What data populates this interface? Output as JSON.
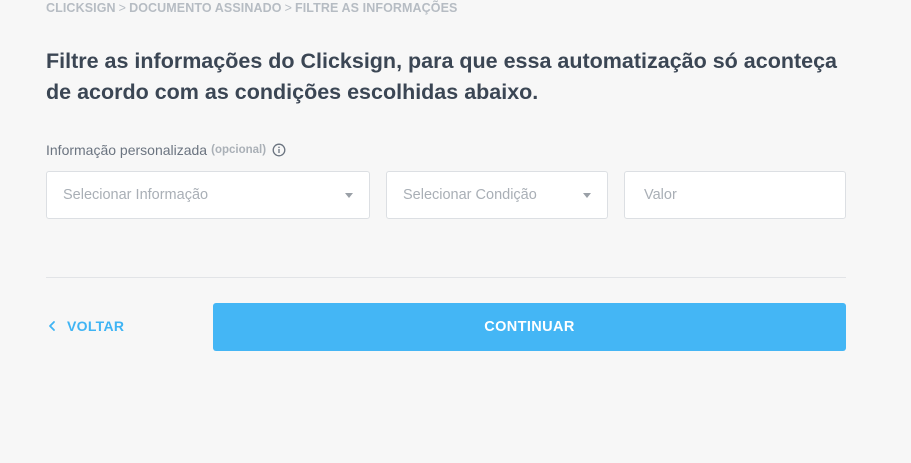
{
  "breadcrumb": {
    "items": [
      "CLICKSIGN",
      "DOCUMENTO ASSINADO",
      "FILTRE AS INFORMAÇÕES"
    ],
    "separator": ">"
  },
  "title": "Filtre as informações do Clicksign, para que essa automatização só aconteça de acordo com as condições escolhidas abaixo.",
  "filter": {
    "label": "Informação personalizada",
    "optional": "(opcional)",
    "info_icon": "info-circle-icon",
    "select_info": {
      "placeholder": "Selecionar Informação"
    },
    "select_condition": {
      "placeholder": "Selecionar Condição"
    },
    "value": {
      "placeholder": "Valor"
    }
  },
  "actions": {
    "back_label": "VOLTAR",
    "continue_label": "CONTINUAR"
  },
  "colors": {
    "accent": "#44b6f5",
    "title": "#3b4654",
    "breadcrumb": "#b6bcc3",
    "background": "#f7f7f7"
  }
}
